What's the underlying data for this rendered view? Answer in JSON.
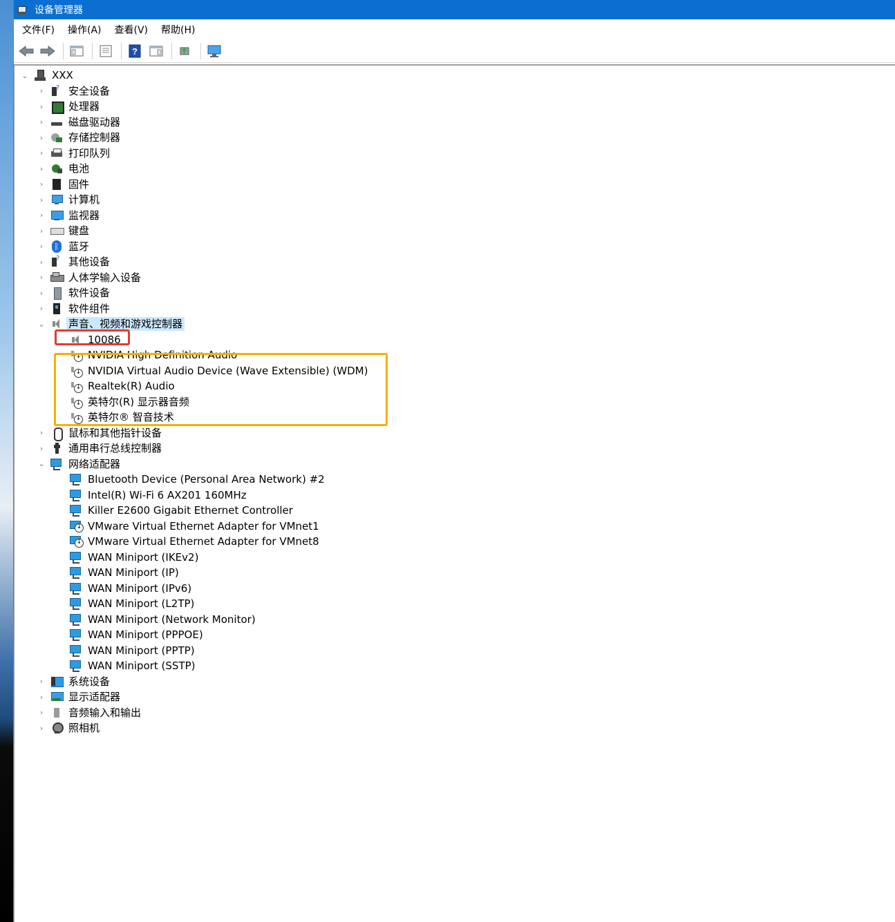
{
  "window": {
    "title": "设备管理器"
  },
  "menu": [
    "文件(F)",
    "操作(A)",
    "查看(V)",
    "帮助(H)"
  ],
  "toolbar": [
    {
      "name": "back-icon"
    },
    {
      "name": "forward-icon"
    },
    {
      "name": "show-hide-console-tree-icon"
    },
    {
      "name": "properties-icon"
    },
    {
      "name": "help-icon"
    },
    {
      "name": "action-pane-icon"
    },
    {
      "name": "update-driver-icon"
    },
    {
      "name": "scan-hardware-icon"
    }
  ],
  "tree": {
    "root": "XXX",
    "categories": [
      {
        "label": "安全设备",
        "icon": "security-device-icon",
        "expanded": false
      },
      {
        "label": "处理器",
        "icon": "processor-icon",
        "expanded": false
      },
      {
        "label": "磁盘驱动器",
        "icon": "disk-drive-icon",
        "expanded": false
      },
      {
        "label": "存储控制器",
        "icon": "storage-controller-icon",
        "expanded": false
      },
      {
        "label": "打印队列",
        "icon": "printer-icon",
        "expanded": false
      },
      {
        "label": "电池",
        "icon": "battery-icon",
        "expanded": false
      },
      {
        "label": "固件",
        "icon": "firmware-icon",
        "expanded": false
      },
      {
        "label": "计算机",
        "icon": "computer-icon",
        "expanded": false
      },
      {
        "label": "监视器",
        "icon": "monitor-icon",
        "expanded": false
      },
      {
        "label": "键盘",
        "icon": "keyboard-icon",
        "expanded": false
      },
      {
        "label": "蓝牙",
        "icon": "bluetooth-icon",
        "expanded": false
      },
      {
        "label": "其他设备",
        "icon": "other-device-icon",
        "expanded": false
      },
      {
        "label": "人体学输入设备",
        "icon": "hid-icon",
        "expanded": false
      },
      {
        "label": "软件设备",
        "icon": "software-device-icon",
        "expanded": false
      },
      {
        "label": "软件组件",
        "icon": "software-component-icon",
        "expanded": false
      },
      {
        "label": "声音、视频和游戏控制器",
        "icon": "speaker-icon",
        "expanded": true,
        "selected": true,
        "children": [
          {
            "label": "10086",
            "icon": "speaker-icon"
          },
          {
            "label": "NVIDIA High Definition Audio",
            "icon": "speaker-disabled-icon"
          },
          {
            "label": "NVIDIA Virtual Audio Device (Wave Extensible) (WDM)",
            "icon": "speaker-disabled-icon"
          },
          {
            "label": "Realtek(R) Audio",
            "icon": "speaker-disabled-icon"
          },
          {
            "label": "英特尔(R) 显示器音频",
            "icon": "speaker-disabled-icon"
          },
          {
            "label": "英特尔® 智音技术",
            "icon": "speaker-disabled-icon"
          }
        ]
      },
      {
        "label": "鼠标和其他指针设备",
        "icon": "mouse-icon",
        "expanded": false
      },
      {
        "label": "通用串行总线控制器",
        "icon": "usb-icon",
        "expanded": false
      },
      {
        "label": "网络适配器",
        "icon": "network-adapter-icon",
        "expanded": true,
        "children": [
          {
            "label": "Bluetooth Device (Personal Area Network) #2",
            "icon": "network-adapter-icon"
          },
          {
            "label": "Intel(R) Wi-Fi 6 AX201 160MHz",
            "icon": "network-adapter-icon"
          },
          {
            "label": "Killer E2600 Gigabit Ethernet Controller",
            "icon": "network-adapter-icon"
          },
          {
            "label": "VMware Virtual Ethernet Adapter for VMnet1",
            "icon": "network-adapter-disabled-icon"
          },
          {
            "label": "VMware Virtual Ethernet Adapter for VMnet8",
            "icon": "network-adapter-disabled-icon"
          },
          {
            "label": "WAN Miniport (IKEv2)",
            "icon": "network-adapter-icon"
          },
          {
            "label": "WAN Miniport (IP)",
            "icon": "network-adapter-icon"
          },
          {
            "label": "WAN Miniport (IPv6)",
            "icon": "network-adapter-icon"
          },
          {
            "label": "WAN Miniport (L2TP)",
            "icon": "network-adapter-icon"
          },
          {
            "label": "WAN Miniport (Network Monitor)",
            "icon": "network-adapter-icon"
          },
          {
            "label": "WAN Miniport (PPPOE)",
            "icon": "network-adapter-icon"
          },
          {
            "label": "WAN Miniport (PPTP)",
            "icon": "network-adapter-icon"
          },
          {
            "label": "WAN Miniport (SSTP)",
            "icon": "network-adapter-icon"
          }
        ]
      },
      {
        "label": "系统设备",
        "icon": "system-device-icon",
        "expanded": false
      },
      {
        "label": "显示适配器",
        "icon": "display-adapter-icon",
        "expanded": false
      },
      {
        "label": "音频输入和输出",
        "icon": "audio-io-icon",
        "expanded": false
      },
      {
        "label": "照相机",
        "icon": "camera-icon",
        "expanded": false
      }
    ]
  },
  "colors": {
    "titlebar": "#0a6fd1",
    "selection": "#cce8ff",
    "highlight_red": "#e53935",
    "highlight_orange": "#f5b000"
  }
}
